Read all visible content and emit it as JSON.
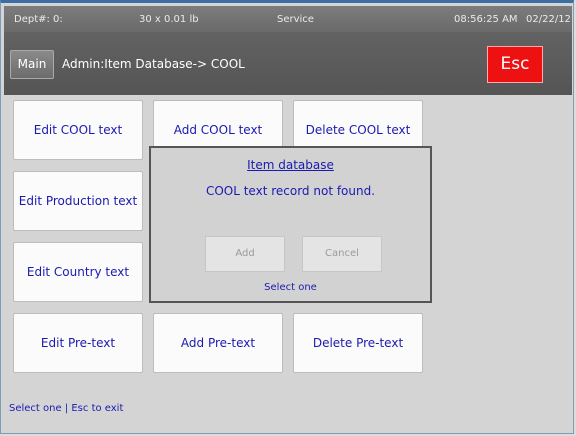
{
  "status": {
    "dept": "Dept#: 0:",
    "weight": "30 x 0.01 lb",
    "mode": "Service",
    "time": "08:56:25 AM",
    "date": "02/22/12"
  },
  "header": {
    "main_label": "Main",
    "breadcrumb": "Admin:Item Database-> COOL",
    "esc_label": "Esc"
  },
  "tiles": [
    {
      "label": "Edit COOL text"
    },
    {
      "label": "Add COOL text"
    },
    {
      "label": "Delete COOL text"
    },
    {
      "label": "Edit Production text"
    },
    {
      "label": "Edit Country text"
    },
    {
      "label": "Edit Pre-text"
    },
    {
      "label": "Add Pre-text"
    },
    {
      "label": "Delete Pre-text"
    }
  ],
  "dialog": {
    "title": "Item database",
    "message": "COOL text record not found.",
    "add_label": "Add",
    "cancel_label": "Cancel",
    "hint": "Select one"
  },
  "footer": {
    "hint": "Select one | Esc to exit"
  }
}
